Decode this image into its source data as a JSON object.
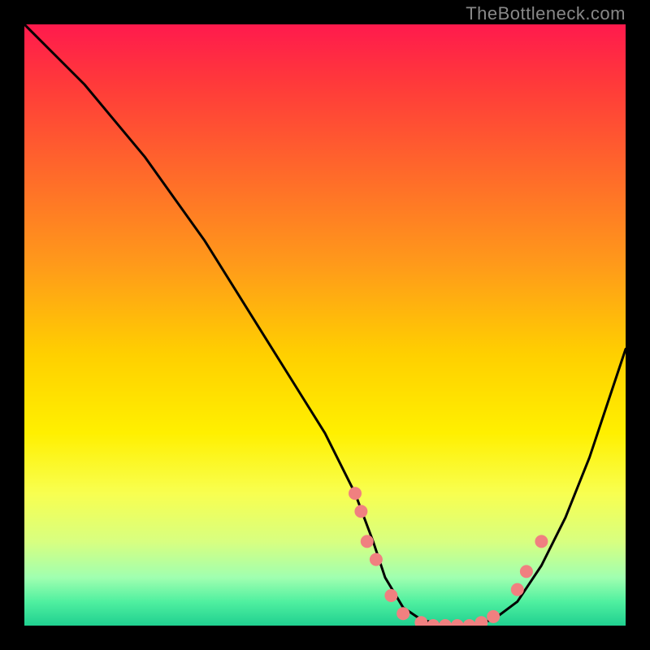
{
  "watermark": "TheBottleneck.com",
  "chart_data": {
    "type": "line",
    "title": "",
    "xlabel": "",
    "ylabel": "",
    "xlim": [
      0,
      100
    ],
    "ylim": [
      0,
      100
    ],
    "curve": {
      "name": "bottleneck-curve",
      "color": "#000000",
      "x": [
        0,
        5,
        10,
        15,
        20,
        25,
        30,
        35,
        40,
        45,
        50,
        55,
        58,
        60,
        63,
        66,
        70,
        74,
        78,
        82,
        86,
        90,
        94,
        98,
        100
      ],
      "y": [
        100,
        95,
        90,
        84,
        78,
        71,
        64,
        56,
        48,
        40,
        32,
        22,
        14,
        8,
        3,
        1,
        0,
        0,
        1,
        4,
        10,
        18,
        28,
        40,
        46
      ]
    },
    "markers": {
      "name": "highlight-points",
      "color": "#f08080",
      "radius": 8,
      "points": [
        {
          "x": 55,
          "y": 22
        },
        {
          "x": 56,
          "y": 19
        },
        {
          "x": 57,
          "y": 14
        },
        {
          "x": 58.5,
          "y": 11
        },
        {
          "x": 61,
          "y": 5
        },
        {
          "x": 63,
          "y": 2
        },
        {
          "x": 66,
          "y": 0.5
        },
        {
          "x": 68,
          "y": 0
        },
        {
          "x": 70,
          "y": 0
        },
        {
          "x": 72,
          "y": 0
        },
        {
          "x": 74,
          "y": 0
        },
        {
          "x": 76,
          "y": 0.5
        },
        {
          "x": 78,
          "y": 1.5
        },
        {
          "x": 82,
          "y": 6
        },
        {
          "x": 83.5,
          "y": 9
        },
        {
          "x": 86,
          "y": 14
        }
      ]
    },
    "gradient_stops": [
      {
        "pos": 0,
        "color": "#ff1a4d"
      },
      {
        "pos": 25,
        "color": "#ff6a2a"
      },
      {
        "pos": 55,
        "color": "#ffd000"
      },
      {
        "pos": 78,
        "color": "#f8ff50"
      },
      {
        "pos": 100,
        "color": "#20d090"
      }
    ]
  }
}
